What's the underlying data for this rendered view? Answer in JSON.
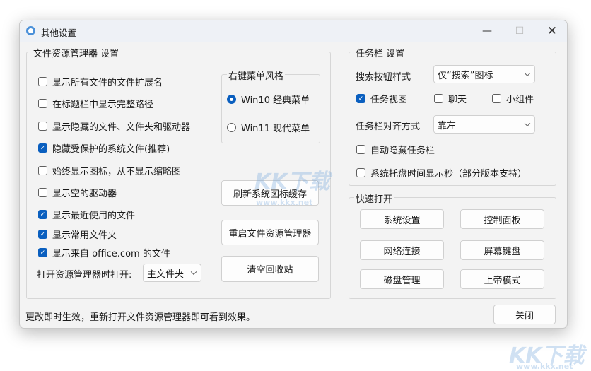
{
  "window": {
    "title": "其他设置"
  },
  "explorer": {
    "title": "文件资源管理器 设置",
    "checks": [
      {
        "label": "显示所有文件的文件扩展名",
        "checked": false
      },
      {
        "label": "在标题栏中显示完整路径",
        "checked": false
      },
      {
        "label": "显示隐藏的文件、文件夹和驱动器",
        "checked": false
      },
      {
        "label": "隐藏受保护的系统文件(推荐)",
        "checked": true
      },
      {
        "label": "始终显示图标，从不显示缩略图",
        "checked": false
      },
      {
        "label": "显示空的驱动器",
        "checked": false
      },
      {
        "label": "显示最近使用的文件",
        "checked": true
      },
      {
        "label": "显示常用文件夹",
        "checked": true
      },
      {
        "label": "显示来自 office.com 的文件",
        "checked": true
      }
    ],
    "context_menu": {
      "title": "右键菜单风格",
      "options": [
        {
          "label": "Win10 经典菜单",
          "selected": true
        },
        {
          "label": "Win11 现代菜单",
          "selected": false
        }
      ]
    },
    "buttons": [
      "刷新系统图标缓存",
      "重启文件资源管理器",
      "清空回收站"
    ],
    "open_label": "打开资源管理器时打开:",
    "open_value": "主文件夹"
  },
  "taskbar": {
    "title": "任务栏 设置",
    "search_label": "搜索按钮样式",
    "search_value": "仅“搜索”图标",
    "checks_row": [
      {
        "label": "任务视图",
        "checked": true
      },
      {
        "label": "聊天",
        "checked": false
      },
      {
        "label": "小组件",
        "checked": false
      }
    ],
    "align_label": "任务栏对齐方式",
    "align_value": "靠左",
    "checks": [
      {
        "label": "自动隐藏任务栏",
        "checked": false
      },
      {
        "label": "系统托盘时间显示秒（部分版本支持）",
        "checked": false
      }
    ]
  },
  "quick": {
    "title": "快速打开",
    "buttons": [
      "系统设置",
      "控制面板",
      "网络连接",
      "屏幕键盘",
      "磁盘管理",
      "上帝模式"
    ]
  },
  "footer": {
    "note": "更改即时生效，重新打开文件资源管理器即可看到效果。",
    "close": "关闭"
  },
  "watermark": {
    "brand": "KK下载",
    "url": "www.kkx.net"
  }
}
